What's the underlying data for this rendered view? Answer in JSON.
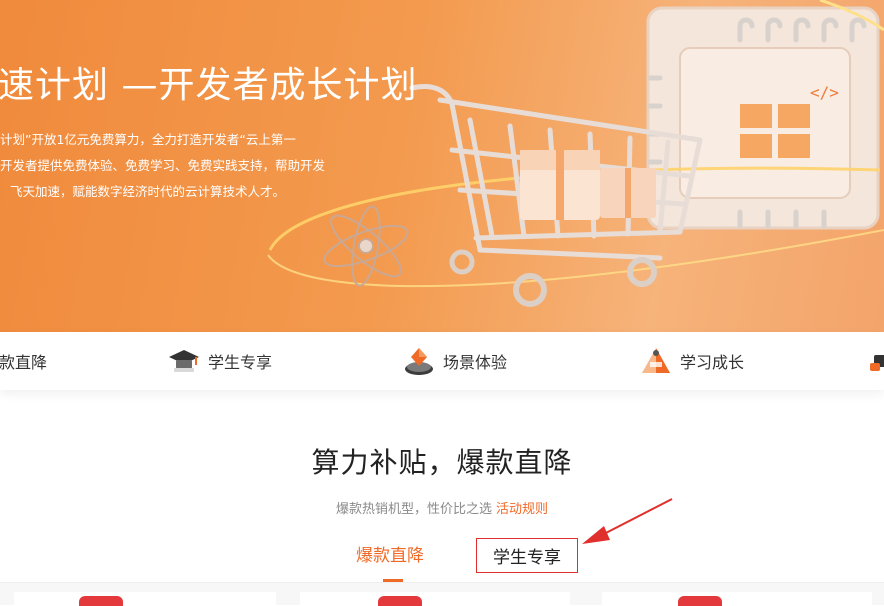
{
  "hero": {
    "title": "速计划 —开发者成长计划",
    "desc_lines": [
      "计划”开放1亿元免费算力，全力打造开发者“云上第一",
      "开发者提供免费体验、免费学习、免费实践支持，帮助开发",
      "飞天加速，赋能数字经济时代的云计算技术人才。"
    ]
  },
  "category_nav": {
    "items": [
      {
        "label": "款直降",
        "icon": "price-drop-icon"
      },
      {
        "label": "学生专享",
        "icon": "graduation-cap-icon"
      },
      {
        "label": "场景体验",
        "icon": "scenario-icon"
      },
      {
        "label": "学习成长",
        "icon": "growth-icon"
      }
    ]
  },
  "section": {
    "title": "算力补贴，爆款直降",
    "subtitle": "爆款热销机型，性价比之选",
    "rules_link": "活动规则"
  },
  "tabs": {
    "hot": "爆款直降",
    "student": "学生专享"
  },
  "colors": {
    "accent": "#f06a27",
    "annotation_red": "#e0302d",
    "hero_orange": "#f08a3c"
  }
}
